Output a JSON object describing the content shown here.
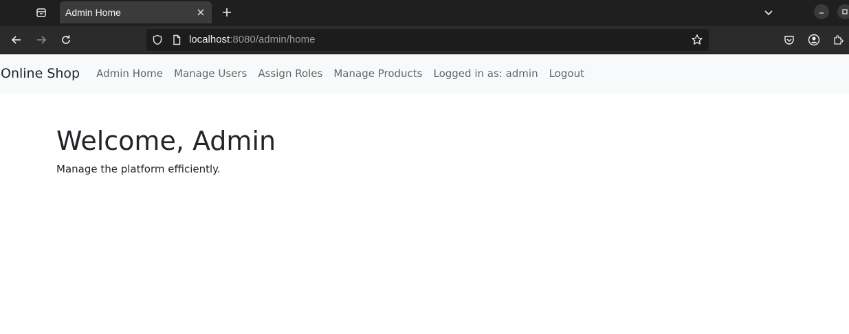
{
  "browser": {
    "tab": {
      "title": "Admin Home"
    },
    "url": {
      "host": "localhost",
      "rest": ":8080/admin/home"
    }
  },
  "navbar": {
    "brand": "Online Shop",
    "links": [
      "Admin Home",
      "Manage Users",
      "Assign Roles",
      "Manage Products"
    ],
    "logged_in_text": "Logged in as: admin",
    "logout": "Logout"
  },
  "main": {
    "heading": "Welcome, Admin",
    "subtitle": "Manage the platform efficiently."
  },
  "colors": {
    "navbar_bg": "#f8f9fa",
    "text": "#212529",
    "chrome_dark": "#1f1f1f"
  }
}
